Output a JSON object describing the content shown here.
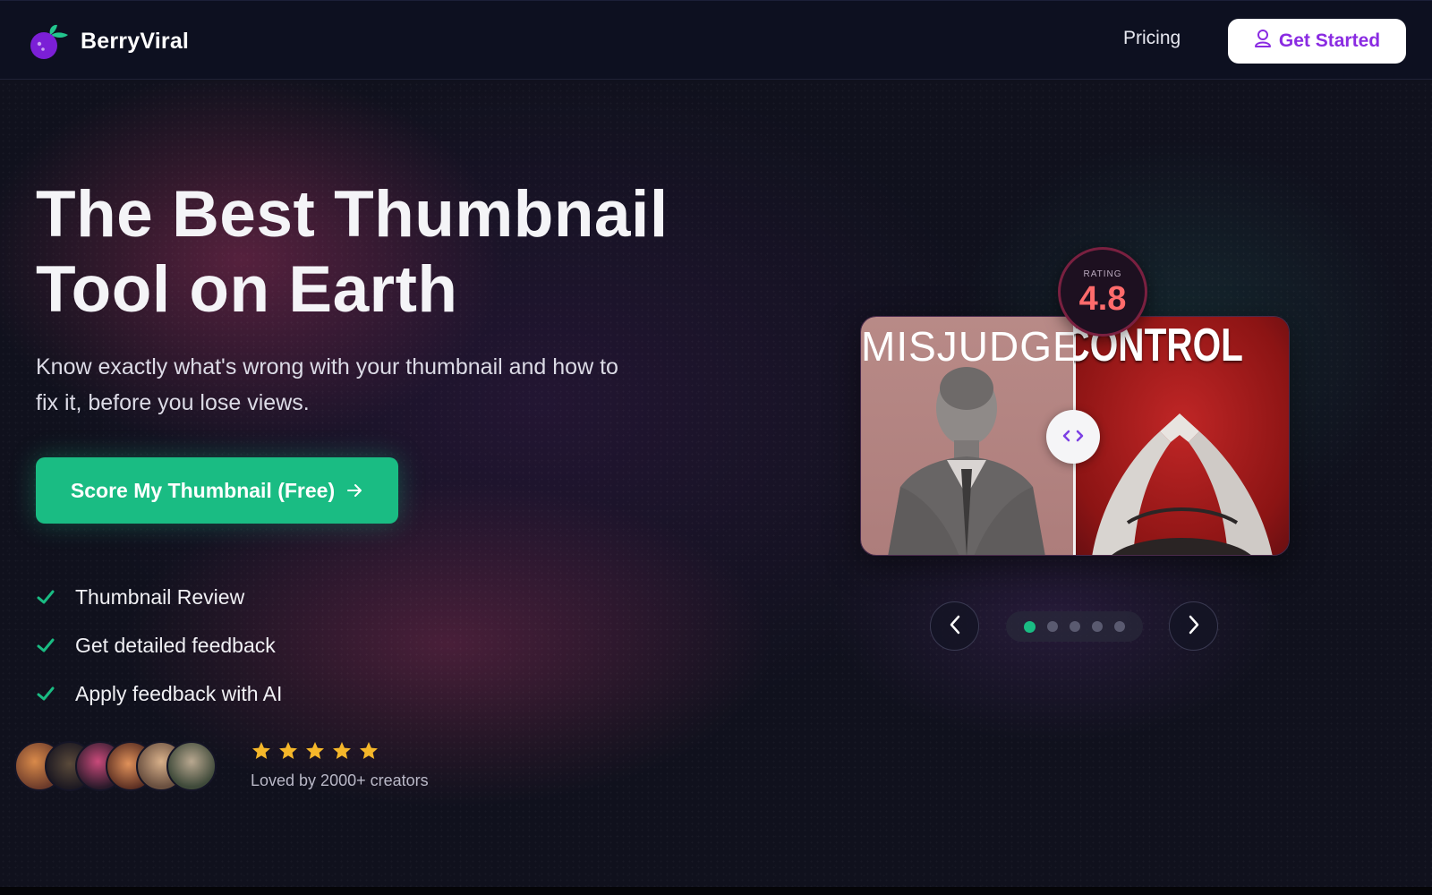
{
  "brand": {
    "name": "BerryViral",
    "colors": {
      "berry": "#7b1fd6",
      "leaf": "#22c58d"
    }
  },
  "nav": {
    "pricing_label": "Pricing",
    "cta_label": "Get Started",
    "cta_icon": "user-icon"
  },
  "hero": {
    "title_line1": "The Best Thumbnail",
    "title_line2": "Tool on Earth",
    "subtitle_line1": "Know exactly what's wrong with your thumbnail and how to",
    "subtitle_line2": "fix it, before you lose views.",
    "cta_label": "Score My Thumbnail (Free)",
    "cta_icon": "arrow-right-icon",
    "cta_color": "#1abc83"
  },
  "features": [
    {
      "label": "Thumbnail Review",
      "icon": "check-icon"
    },
    {
      "label": "Get detailed feedback",
      "icon": "check-icon"
    },
    {
      "label": "Apply feedback with AI",
      "icon": "check-icon"
    }
  ],
  "social_proof": {
    "stars": 5,
    "star_color": "#f5b72a",
    "caption": "Loved by 2000+ creators",
    "avatar_count": 6
  },
  "showcase": {
    "rating_label": "RATING",
    "rating_value": "4.8",
    "rating_color": "#ff6b6b",
    "before_text": "MISJUDGED",
    "after_text": "YS IN CONTROL",
    "handle_icon": "code-brackets-icon",
    "prev_icon": "chevron-left-icon",
    "next_icon": "chevron-right-icon",
    "slides": 5,
    "active_slide": 1
  }
}
